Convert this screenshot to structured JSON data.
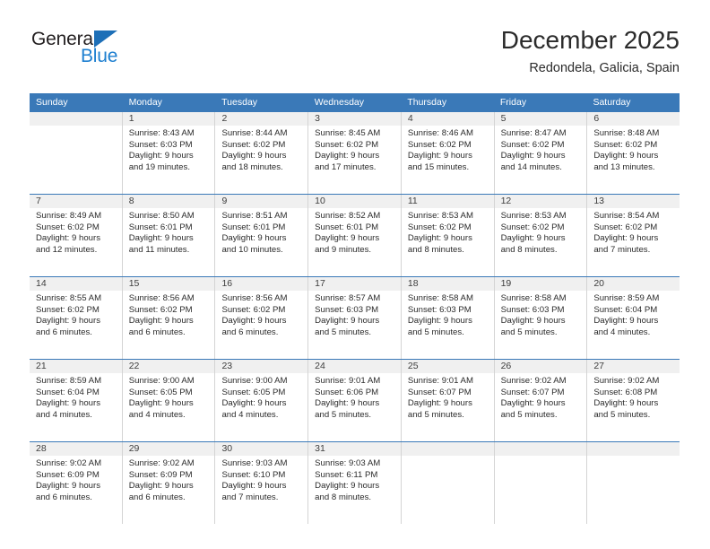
{
  "brand": {
    "name_part1": "General",
    "name_part2": "Blue",
    "triangle_icon": "triangle-icon",
    "color_dark": "#231f20",
    "color_blue": "#1d7fd0"
  },
  "header": {
    "title": "December 2025",
    "subtitle": "Redondela, Galicia, Spain"
  },
  "colors": {
    "header_blue": "#3a79b8",
    "daynum_band": "#f0f0f0",
    "cell_border": "#d4d4d4",
    "text": "#2b2b2b"
  },
  "calendar": {
    "weekdays": [
      "Sunday",
      "Monday",
      "Tuesday",
      "Wednesday",
      "Thursday",
      "Friday",
      "Saturday"
    ],
    "weeks": [
      [
        {
          "day": "",
          "empty": true,
          "sunrise": "",
          "sunset": "",
          "daylight_line1": "",
          "daylight_line2": ""
        },
        {
          "day": "1",
          "sunrise": "Sunrise: 8:43 AM",
          "sunset": "Sunset: 6:03 PM",
          "daylight_line1": "Daylight: 9 hours",
          "daylight_line2": "and 19 minutes."
        },
        {
          "day": "2",
          "sunrise": "Sunrise: 8:44 AM",
          "sunset": "Sunset: 6:02 PM",
          "daylight_line1": "Daylight: 9 hours",
          "daylight_line2": "and 18 minutes."
        },
        {
          "day": "3",
          "sunrise": "Sunrise: 8:45 AM",
          "sunset": "Sunset: 6:02 PM",
          "daylight_line1": "Daylight: 9 hours",
          "daylight_line2": "and 17 minutes."
        },
        {
          "day": "4",
          "sunrise": "Sunrise: 8:46 AM",
          "sunset": "Sunset: 6:02 PM",
          "daylight_line1": "Daylight: 9 hours",
          "daylight_line2": "and 15 minutes."
        },
        {
          "day": "5",
          "sunrise": "Sunrise: 8:47 AM",
          "sunset": "Sunset: 6:02 PM",
          "daylight_line1": "Daylight: 9 hours",
          "daylight_line2": "and 14 minutes."
        },
        {
          "day": "6",
          "sunrise": "Sunrise: 8:48 AM",
          "sunset": "Sunset: 6:02 PM",
          "daylight_line1": "Daylight: 9 hours",
          "daylight_line2": "and 13 minutes."
        }
      ],
      [
        {
          "day": "7",
          "sunrise": "Sunrise: 8:49 AM",
          "sunset": "Sunset: 6:02 PM",
          "daylight_line1": "Daylight: 9 hours",
          "daylight_line2": "and 12 minutes."
        },
        {
          "day": "8",
          "sunrise": "Sunrise: 8:50 AM",
          "sunset": "Sunset: 6:01 PM",
          "daylight_line1": "Daylight: 9 hours",
          "daylight_line2": "and 11 minutes."
        },
        {
          "day": "9",
          "sunrise": "Sunrise: 8:51 AM",
          "sunset": "Sunset: 6:01 PM",
          "daylight_line1": "Daylight: 9 hours",
          "daylight_line2": "and 10 minutes."
        },
        {
          "day": "10",
          "sunrise": "Sunrise: 8:52 AM",
          "sunset": "Sunset: 6:01 PM",
          "daylight_line1": "Daylight: 9 hours",
          "daylight_line2": "and 9 minutes."
        },
        {
          "day": "11",
          "sunrise": "Sunrise: 8:53 AM",
          "sunset": "Sunset: 6:02 PM",
          "daylight_line1": "Daylight: 9 hours",
          "daylight_line2": "and 8 minutes."
        },
        {
          "day": "12",
          "sunrise": "Sunrise: 8:53 AM",
          "sunset": "Sunset: 6:02 PM",
          "daylight_line1": "Daylight: 9 hours",
          "daylight_line2": "and 8 minutes."
        },
        {
          "day": "13",
          "sunrise": "Sunrise: 8:54 AM",
          "sunset": "Sunset: 6:02 PM",
          "daylight_line1": "Daylight: 9 hours",
          "daylight_line2": "and 7 minutes."
        }
      ],
      [
        {
          "day": "14",
          "sunrise": "Sunrise: 8:55 AM",
          "sunset": "Sunset: 6:02 PM",
          "daylight_line1": "Daylight: 9 hours",
          "daylight_line2": "and 6 minutes."
        },
        {
          "day": "15",
          "sunrise": "Sunrise: 8:56 AM",
          "sunset": "Sunset: 6:02 PM",
          "daylight_line1": "Daylight: 9 hours",
          "daylight_line2": "and 6 minutes."
        },
        {
          "day": "16",
          "sunrise": "Sunrise: 8:56 AM",
          "sunset": "Sunset: 6:02 PM",
          "daylight_line1": "Daylight: 9 hours",
          "daylight_line2": "and 6 minutes."
        },
        {
          "day": "17",
          "sunrise": "Sunrise: 8:57 AM",
          "sunset": "Sunset: 6:03 PM",
          "daylight_line1": "Daylight: 9 hours",
          "daylight_line2": "and 5 minutes."
        },
        {
          "day": "18",
          "sunrise": "Sunrise: 8:58 AM",
          "sunset": "Sunset: 6:03 PM",
          "daylight_line1": "Daylight: 9 hours",
          "daylight_line2": "and 5 minutes."
        },
        {
          "day": "19",
          "sunrise": "Sunrise: 8:58 AM",
          "sunset": "Sunset: 6:03 PM",
          "daylight_line1": "Daylight: 9 hours",
          "daylight_line2": "and 5 minutes."
        },
        {
          "day": "20",
          "sunrise": "Sunrise: 8:59 AM",
          "sunset": "Sunset: 6:04 PM",
          "daylight_line1": "Daylight: 9 hours",
          "daylight_line2": "and 4 minutes."
        }
      ],
      [
        {
          "day": "21",
          "sunrise": "Sunrise: 8:59 AM",
          "sunset": "Sunset: 6:04 PM",
          "daylight_line1": "Daylight: 9 hours",
          "daylight_line2": "and 4 minutes."
        },
        {
          "day": "22",
          "sunrise": "Sunrise: 9:00 AM",
          "sunset": "Sunset: 6:05 PM",
          "daylight_line1": "Daylight: 9 hours",
          "daylight_line2": "and 4 minutes."
        },
        {
          "day": "23",
          "sunrise": "Sunrise: 9:00 AM",
          "sunset": "Sunset: 6:05 PM",
          "daylight_line1": "Daylight: 9 hours",
          "daylight_line2": "and 4 minutes."
        },
        {
          "day": "24",
          "sunrise": "Sunrise: 9:01 AM",
          "sunset": "Sunset: 6:06 PM",
          "daylight_line1": "Daylight: 9 hours",
          "daylight_line2": "and 5 minutes."
        },
        {
          "day": "25",
          "sunrise": "Sunrise: 9:01 AM",
          "sunset": "Sunset: 6:07 PM",
          "daylight_line1": "Daylight: 9 hours",
          "daylight_line2": "and 5 minutes."
        },
        {
          "day": "26",
          "sunrise": "Sunrise: 9:02 AM",
          "sunset": "Sunset: 6:07 PM",
          "daylight_line1": "Daylight: 9 hours",
          "daylight_line2": "and 5 minutes."
        },
        {
          "day": "27",
          "sunrise": "Sunrise: 9:02 AM",
          "sunset": "Sunset: 6:08 PM",
          "daylight_line1": "Daylight: 9 hours",
          "daylight_line2": "and 5 minutes."
        }
      ],
      [
        {
          "day": "28",
          "sunrise": "Sunrise: 9:02 AM",
          "sunset": "Sunset: 6:09 PM",
          "daylight_line1": "Daylight: 9 hours",
          "daylight_line2": "and 6 minutes."
        },
        {
          "day": "29",
          "sunrise": "Sunrise: 9:02 AM",
          "sunset": "Sunset: 6:09 PM",
          "daylight_line1": "Daylight: 9 hours",
          "daylight_line2": "and 6 minutes."
        },
        {
          "day": "30",
          "sunrise": "Sunrise: 9:03 AM",
          "sunset": "Sunset: 6:10 PM",
          "daylight_line1": "Daylight: 9 hours",
          "daylight_line2": "and 7 minutes."
        },
        {
          "day": "31",
          "sunrise": "Sunrise: 9:03 AM",
          "sunset": "Sunset: 6:11 PM",
          "daylight_line1": "Daylight: 9 hours",
          "daylight_line2": "and 8 minutes."
        },
        {
          "day": "",
          "empty": true,
          "sunrise": "",
          "sunset": "",
          "daylight_line1": "",
          "daylight_line2": ""
        },
        {
          "day": "",
          "empty": true,
          "sunrise": "",
          "sunset": "",
          "daylight_line1": "",
          "daylight_line2": ""
        },
        {
          "day": "",
          "empty": true,
          "sunrise": "",
          "sunset": "",
          "daylight_line1": "",
          "daylight_line2": ""
        }
      ]
    ]
  }
}
